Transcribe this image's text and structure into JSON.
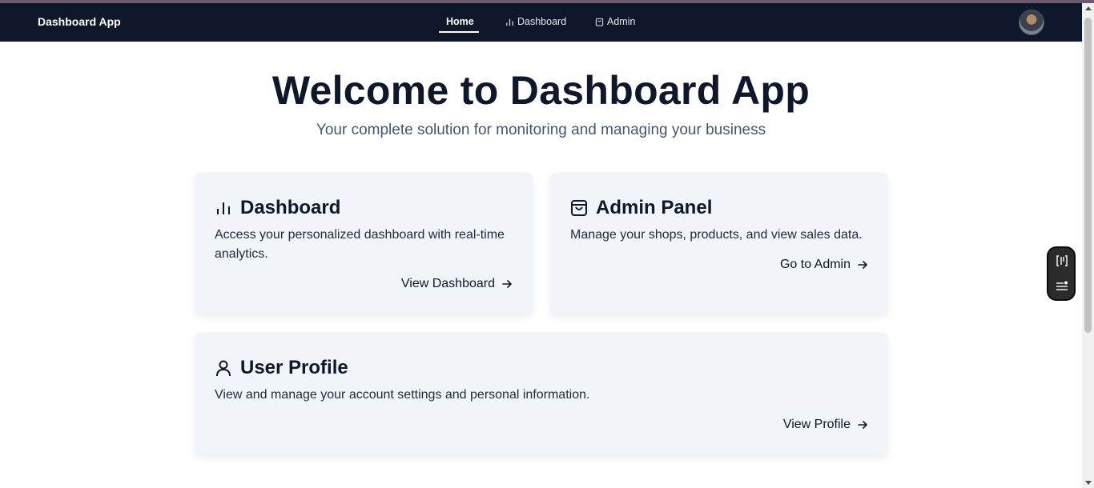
{
  "app": {
    "brand": "Dashboard App"
  },
  "nav": {
    "items": [
      {
        "label": "Home",
        "icon": ""
      },
      {
        "label": "Dashboard",
        "icon": "bar-chart-icon"
      },
      {
        "label": "Admin",
        "icon": "shopping-bag-icon"
      }
    ],
    "active": "Home"
  },
  "hero": {
    "title": "Welcome to Dashboard App",
    "subtitle": "Your complete solution for monitoring and managing your business"
  },
  "cards": [
    {
      "title": "Dashboard",
      "icon": "bar-chart-icon",
      "description": "Access your personalized dashboard with real-time analytics.",
      "link": "View Dashboard"
    },
    {
      "title": "Admin Panel",
      "icon": "shopping-bag-icon",
      "description": "Manage your shops, products, and view sales data.",
      "link": "Go to Admin"
    },
    {
      "title": "User Profile",
      "icon": "user-icon",
      "description": "View and manage your account settings and personal information.",
      "link": "View Profile"
    }
  ],
  "colors": {
    "navbar": "#0f172a",
    "card_bg": "#f1f5f9",
    "text": "#0f172a",
    "muted": "#475569"
  }
}
